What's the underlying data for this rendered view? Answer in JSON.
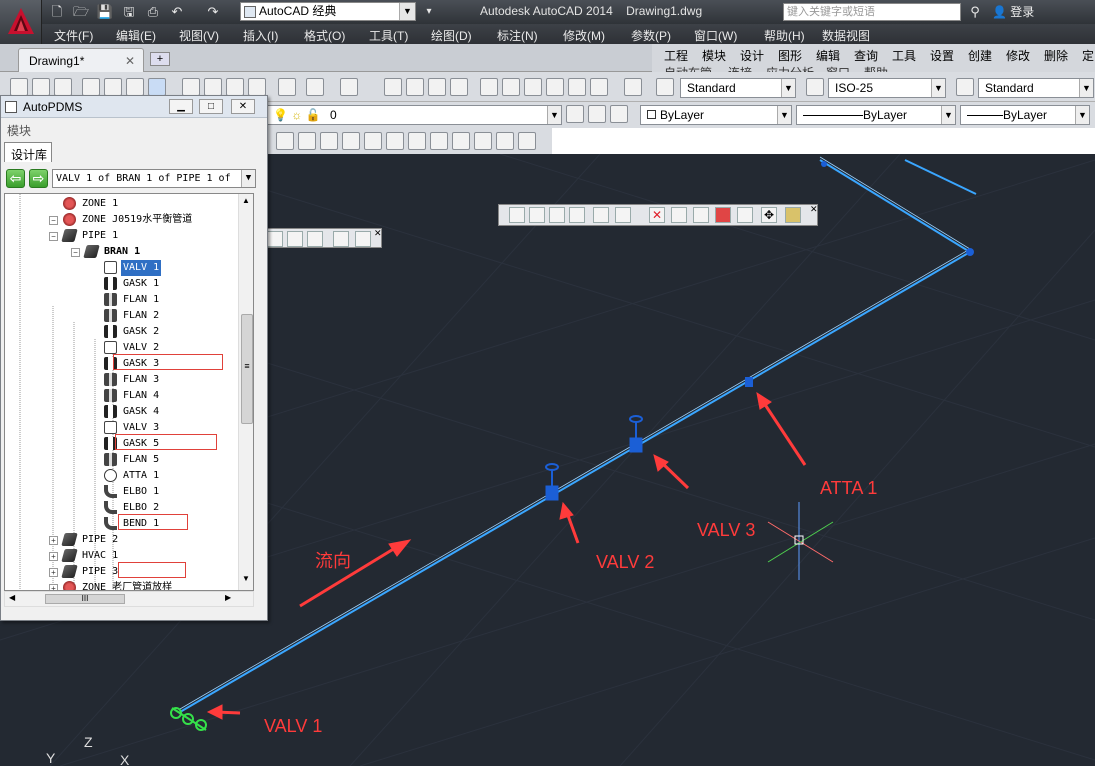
{
  "window": {
    "app_title": "Autodesk AutoCAD 2014",
    "document_name": "Drawing1.dwg",
    "workspace": "AutoCAD 经典",
    "search_placeholder": "键入关键字或短语",
    "login_label": "登录"
  },
  "menubar": [
    "文件(F)",
    "编辑(E)",
    "视图(V)",
    "插入(I)",
    "格式(O)",
    "工具(T)",
    "绘图(D)",
    "标注(N)",
    "修改(M)",
    "参数(P)",
    "窗口(W)",
    "帮助(H)",
    "数据视图"
  ],
  "doc_tabs": {
    "active": "Drawing1*"
  },
  "command_menu": {
    "row1": [
      "工程",
      "模块",
      "设计",
      "图形",
      "编辑",
      "查询",
      "工具",
      "设置",
      "创建",
      "修改",
      "删除",
      "定"
    ],
    "row2": [
      "自动布管",
      "连接",
      "应力分析",
      "窗口",
      "帮助"
    ]
  },
  "styles": {
    "text_style": "Standard",
    "dim_style": "ISO-25",
    "table_style": "Standard"
  },
  "layers": {
    "current_layer": "0",
    "color": "ByLayer",
    "linetype": "ByLayer",
    "lineweight": "ByLayer"
  },
  "pdms_panel": {
    "title": "AutoPDMS",
    "modules_label": "模块",
    "tab_label": "设计库",
    "nav_path": "VALV 1 of BRAN 1 of PIPE 1 of",
    "tree": [
      {
        "label": "ZONE 1",
        "type": "zone"
      },
      {
        "label": "ZONE J0519水平衡管道",
        "type": "zone"
      },
      {
        "label": "PIPE 1",
        "type": "pipe"
      },
      {
        "label": "BRAN 1",
        "type": "pipe"
      },
      {
        "label": "VALV 1",
        "type": "valv"
      },
      {
        "label": "GASK 1",
        "type": "gask"
      },
      {
        "label": "FLAN 1",
        "type": "flan"
      },
      {
        "label": "FLAN 2",
        "type": "flan"
      },
      {
        "label": "GASK 2",
        "type": "gask"
      },
      {
        "label": "VALV 2",
        "type": "valv"
      },
      {
        "label": "GASK 3",
        "type": "gask"
      },
      {
        "label": "FLAN 3",
        "type": "flan"
      },
      {
        "label": "FLAN 4",
        "type": "flan"
      },
      {
        "label": "GASK 4",
        "type": "gask"
      },
      {
        "label": "VALV 3",
        "type": "valv"
      },
      {
        "label": "GASK 5",
        "type": "gask"
      },
      {
        "label": "FLAN 5",
        "type": "flan"
      },
      {
        "label": "ATTA 1",
        "type": "atta"
      },
      {
        "label": "ELBO 1",
        "type": "elbo"
      },
      {
        "label": "ELBO 2",
        "type": "elbo"
      },
      {
        "label": "BEND 1",
        "type": "elbo"
      },
      {
        "label": "PIPE 2",
        "type": "pipe"
      },
      {
        "label": "HVAC 1",
        "type": "pipe"
      },
      {
        "label": "PIPE 3",
        "type": "pipe"
      },
      {
        "label": "ZONE 老厂管道放样",
        "type": "zone"
      }
    ],
    "hscroll_glyph": "III",
    "vscroll_glyph": "≡"
  },
  "annotations": {
    "flow": "流向",
    "valv1": "VALV 1",
    "valv2": "VALV 2",
    "valv3": "VALV 3",
    "atta1": "ATTA 1"
  },
  "axes": {
    "x": "X",
    "y": "Y",
    "z": "Z"
  },
  "colors": {
    "canvas_bg": "#232932",
    "pipe": "#3aa6ff",
    "valve_component": "#1b5fd6",
    "annotation": "#ff3b3b",
    "selected_item": "#2f6fc4"
  }
}
